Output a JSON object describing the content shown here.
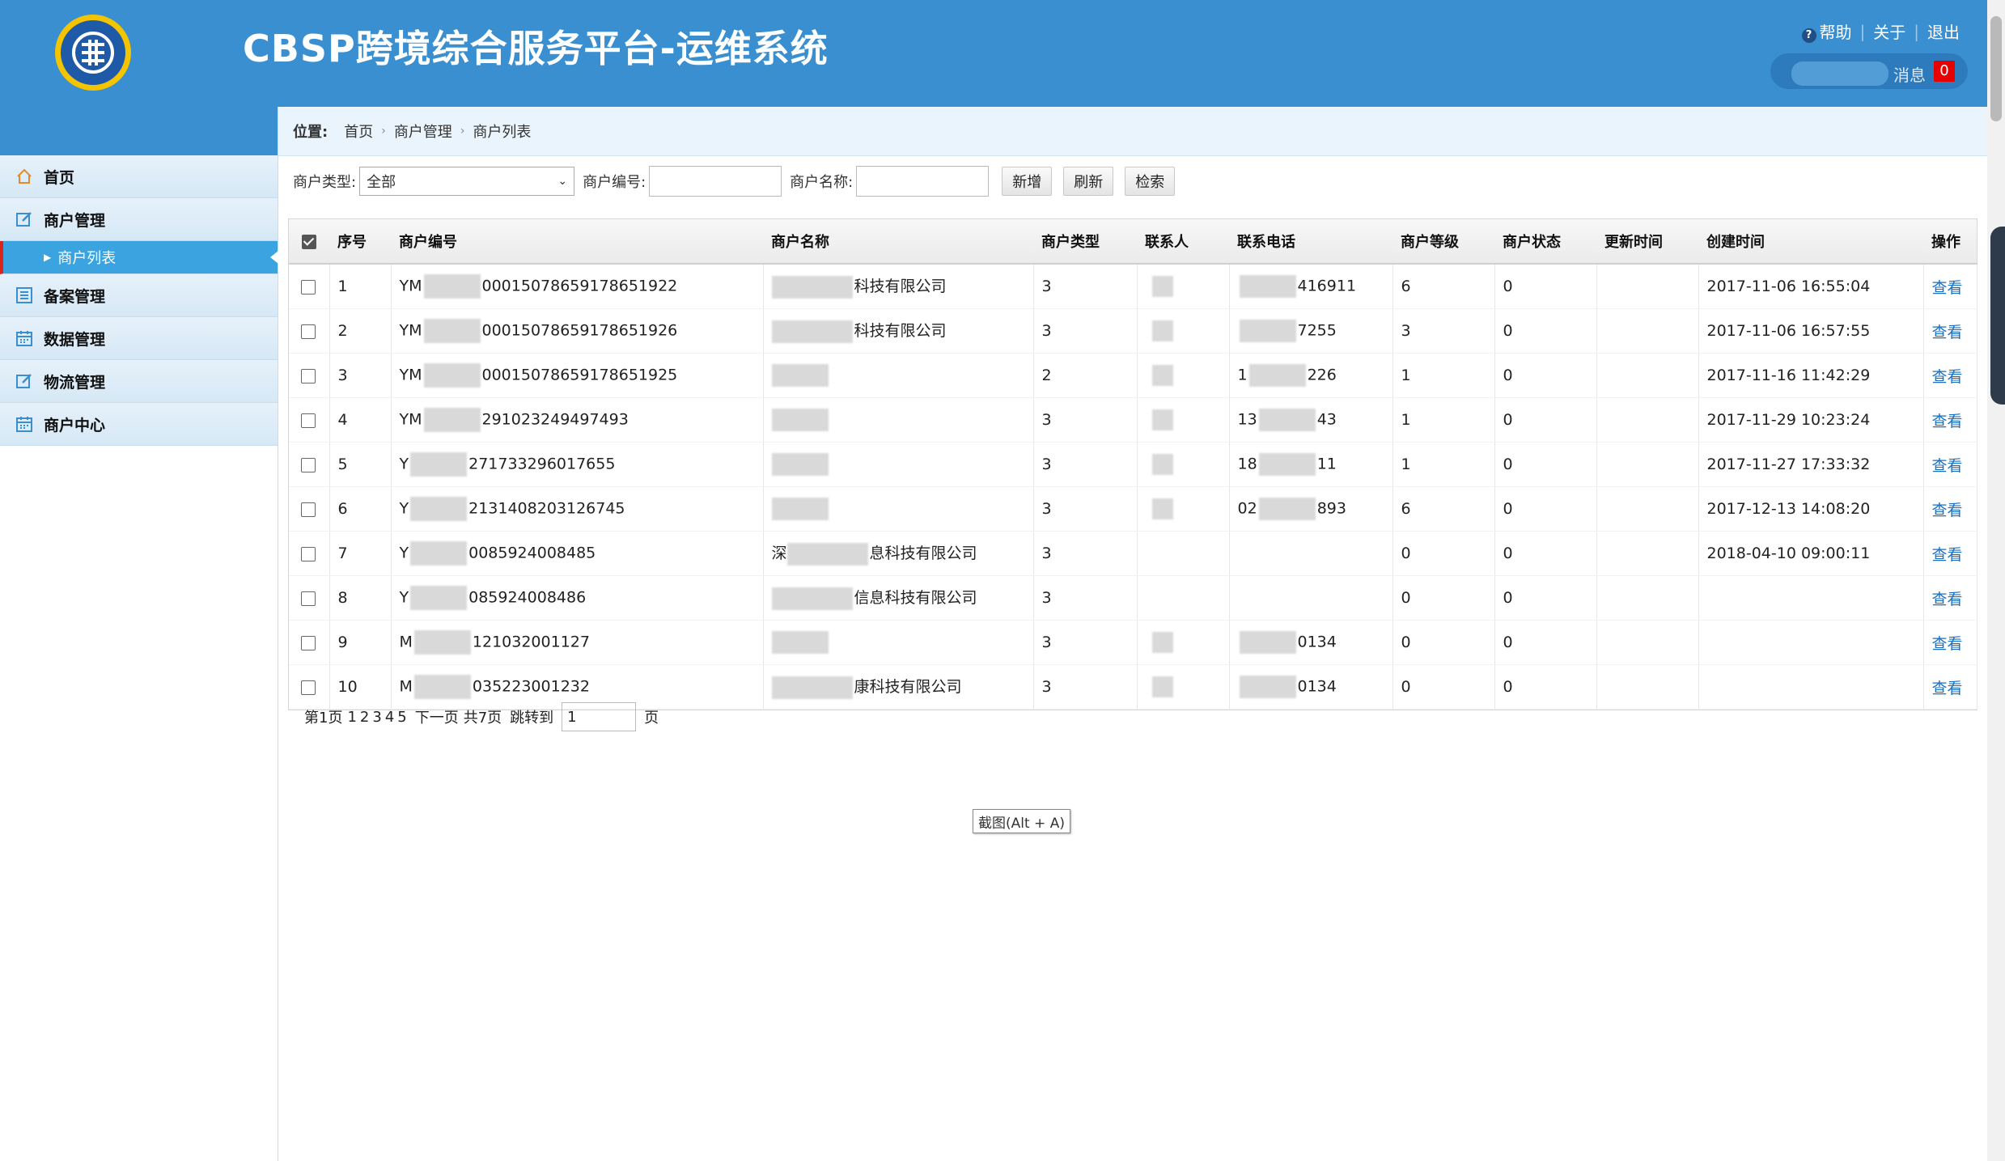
{
  "header": {
    "title": "CBSP跨境综合服务平台-运维系统",
    "help": "帮助",
    "about": "关于",
    "logout": "退出",
    "messages_label": "消息",
    "messages_count": "0"
  },
  "sidebar": {
    "items": [
      {
        "label": "首页",
        "icon": "home-icon"
      },
      {
        "label": "商户管理",
        "icon": "edit-icon"
      },
      {
        "label": "商户列表",
        "icon": "arrow-right-icon",
        "active": true
      },
      {
        "label": "备案管理",
        "icon": "list-icon"
      },
      {
        "label": "数据管理",
        "icon": "calendar-icon"
      },
      {
        "label": "物流管理",
        "icon": "edit-icon"
      },
      {
        "label": "商户中心",
        "icon": "calendar-icon"
      }
    ]
  },
  "breadcrumb": {
    "label": "位置:",
    "items": [
      "首页",
      "商户管理",
      "商户列表"
    ]
  },
  "filters": {
    "type_label": "商户类型:",
    "type_value": "全部",
    "code_label": "商户编号:",
    "name_label": "商户名称:",
    "add": "新增",
    "refresh": "刷新",
    "search": "检索"
  },
  "table": {
    "headers": [
      "序号",
      "商户编号",
      "商户名称",
      "商户类型",
      "联系人",
      "联系电话",
      "商户等级",
      "商户状态",
      "更新时间",
      "创建时间",
      "操作"
    ],
    "rows": [
      {
        "no": "1",
        "code_pre": "YM",
        "code": "0001507865917865192​2",
        "name_pre": "",
        "name": "科技有限公司",
        "type": "3",
        "phone_pre": "",
        "phone": "416911",
        "level": "6",
        "status": "0",
        "updated": "",
        "created": "2017-11-06 16:55:04",
        "action": "查看"
      },
      {
        "no": "2",
        "code_pre": "YM",
        "code": "00015078659178651926",
        "name_pre": "",
        "name": "科技有限公司",
        "type": "3",
        "phone_pre": "",
        "phone": "7255",
        "level": "3",
        "status": "0",
        "updated": "",
        "created": "2017-11-06 16:57:55",
        "action": "查看"
      },
      {
        "no": "3",
        "code_pre": "YM",
        "code": "00015078659178651925",
        "name_pre": "",
        "name": "",
        "type": "2",
        "phone_pre": "1",
        "phone": "226",
        "level": "1",
        "status": "0",
        "updated": "",
        "created": "2017-11-16 11:42:29",
        "action": "查看"
      },
      {
        "no": "4",
        "code_pre": "YM",
        "code": "291023249497493",
        "name_pre": "",
        "name": "",
        "type": "3",
        "phone_pre": "13",
        "phone": "43",
        "level": "1",
        "status": "0",
        "updated": "",
        "created": "2017-11-29 10:23:24",
        "action": "查看"
      },
      {
        "no": "5",
        "code_pre": "Y",
        "code": "271733296017655",
        "name_pre": "",
        "name": "",
        "type": "3",
        "phone_pre": "18",
        "phone": "11",
        "level": "1",
        "status": "0",
        "updated": "",
        "created": "2017-11-27 17:33:32",
        "action": "查看"
      },
      {
        "no": "6",
        "code_pre": "Y",
        "code": "2131408203126745",
        "name_pre": "",
        "name": "",
        "type": "3",
        "phone_pre": "02",
        "phone": "893",
        "level": "6",
        "status": "0",
        "updated": "",
        "created": "2017-12-13 14:08:20",
        "action": "查看"
      },
      {
        "no": "7",
        "code_pre": "Y",
        "code": "0085924008485",
        "name_pre": "深",
        "name": "息科技有限公司",
        "type": "3",
        "phone_pre": "",
        "phone": "",
        "level": "0",
        "status": "0",
        "updated": "",
        "created": "2018-04-10 09:00:11",
        "action": "查看"
      },
      {
        "no": "8",
        "code_pre": "Y",
        "code": "085924008486",
        "name_pre": "",
        "name": "信息科技有限公司",
        "type": "3",
        "phone_pre": "",
        "phone": "",
        "level": "0",
        "status": "0",
        "updated": "",
        "created": "",
        "action": "查看"
      },
      {
        "no": "9",
        "code_pre": "M",
        "code": "121032001127",
        "name_pre": "",
        "name": "",
        "type": "3",
        "phone_pre": "",
        "phone": "0134",
        "level": "0",
        "status": "0",
        "updated": "",
        "created": "",
        "action": "查看"
      },
      {
        "no": "10",
        "code_pre": "M",
        "code": "035223001232",
        "name_pre": "",
        "name": "康科技有限公司",
        "type": "3",
        "phone_pre": "",
        "phone": "0134",
        "level": "0",
        "status": "0",
        "updated": "",
        "created": "",
        "action": "查看"
      }
    ]
  },
  "pagination": {
    "current": "第1页",
    "pages": [
      "1",
      "2",
      "3",
      "4",
      "5"
    ],
    "next": "下一页",
    "total": "共7页",
    "jump_label": "跳转到",
    "jump_value": "1",
    "page_suffix": "页"
  },
  "tooltip": "截图(Alt + A)",
  "colors": {
    "header_bg": "#3a8fd0",
    "active_menu": "#3aa3e0",
    "link": "#1a6fc0",
    "badge": "#e60000"
  }
}
